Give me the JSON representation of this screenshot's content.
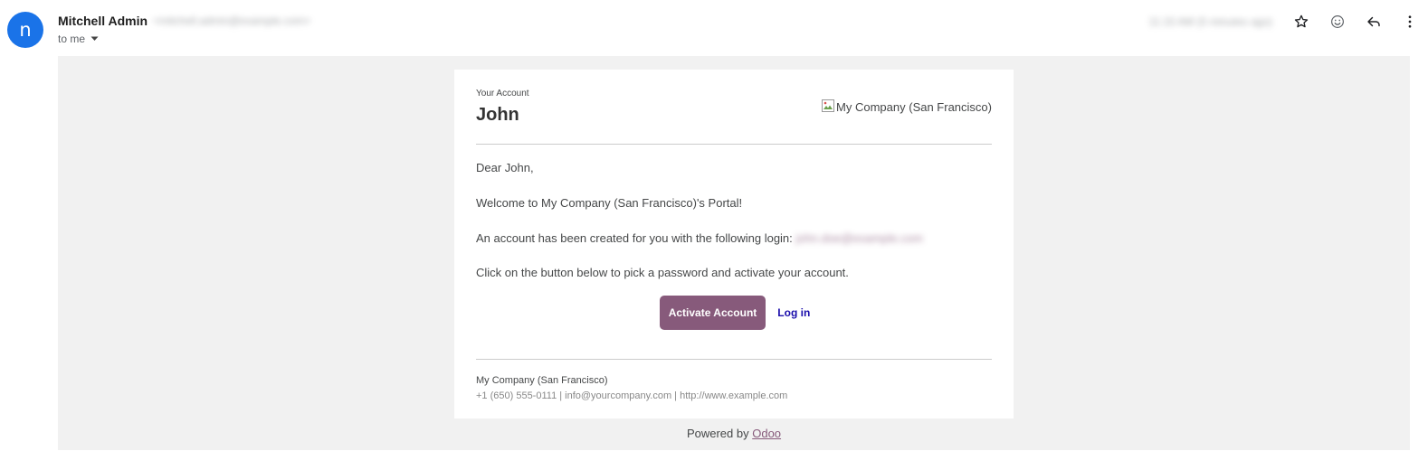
{
  "sender": {
    "avatar_letter": "n",
    "name": "Mitchell Admin",
    "email": "<mitchell.admin@example.com>",
    "recipient": "to me",
    "timestamp": "11:15 AM (5 minutes ago)"
  },
  "header_actions": {
    "icons": [
      "star-icon",
      "emoji-icon",
      "reply-icon",
      "more-vert-icon"
    ]
  },
  "email": {
    "your_account_label": "Your Account",
    "customer_name": "John",
    "logo_alt": "My Company (San Francisco)",
    "greeting": "Dear John,",
    "welcome": "Welcome to My Company (San Francisco)'s Portal!",
    "login_prefix": "An account has been created for you with the following login:",
    "login_email": "john.doe@example.com",
    "instruction": "Click on the button below to pick a password and activate your account.",
    "activate_label": "Activate Account",
    "login_label": "Log in",
    "footer_company": "My Company (San Francisco)",
    "footer_contact": "+1 (650) 555-0111 | info@yourcompany.com | http://www.example.com",
    "powered_by": "Powered by",
    "odoo_link": "Odoo"
  },
  "colors": {
    "avatar": "#1a73e8",
    "brand": "#875a7b",
    "frame_bg": "#f1f1f1",
    "link": "#1a0dab"
  }
}
